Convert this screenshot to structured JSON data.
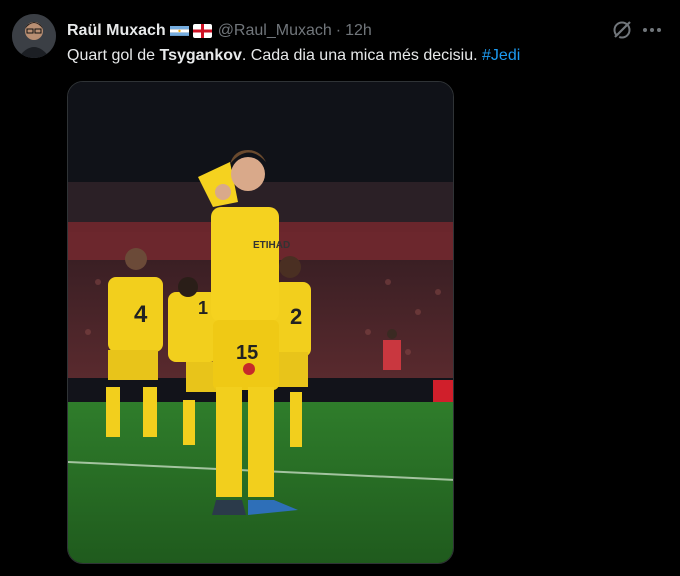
{
  "tweet": {
    "author_name": "Raül Muxach",
    "handle": "@Raul_Muxach",
    "separator": "·",
    "time": "12h",
    "text_part1": "Quart gol de ",
    "text_bold": "Tsygankov",
    "text_part2": ". Cada dia una mica més decisiu. ",
    "hashtag": "#Jedi",
    "badges": [
      "argentina-flag-emoji",
      "england-flag-emoji"
    ]
  },
  "actions": {
    "grok_icon": "grok-icon",
    "more_icon": "more-icon"
  },
  "media": {
    "jersey_numbers": [
      "4",
      "1",
      "15",
      "2"
    ],
    "shirt_sponsor": "ETIHAD"
  },
  "colors": {
    "background": "#000000",
    "text": "#e7e9ea",
    "muted": "#71767b",
    "link": "#1d9bf0",
    "kit_yellow": "#f2cf1d",
    "pitch": "#2f7d2b"
  }
}
